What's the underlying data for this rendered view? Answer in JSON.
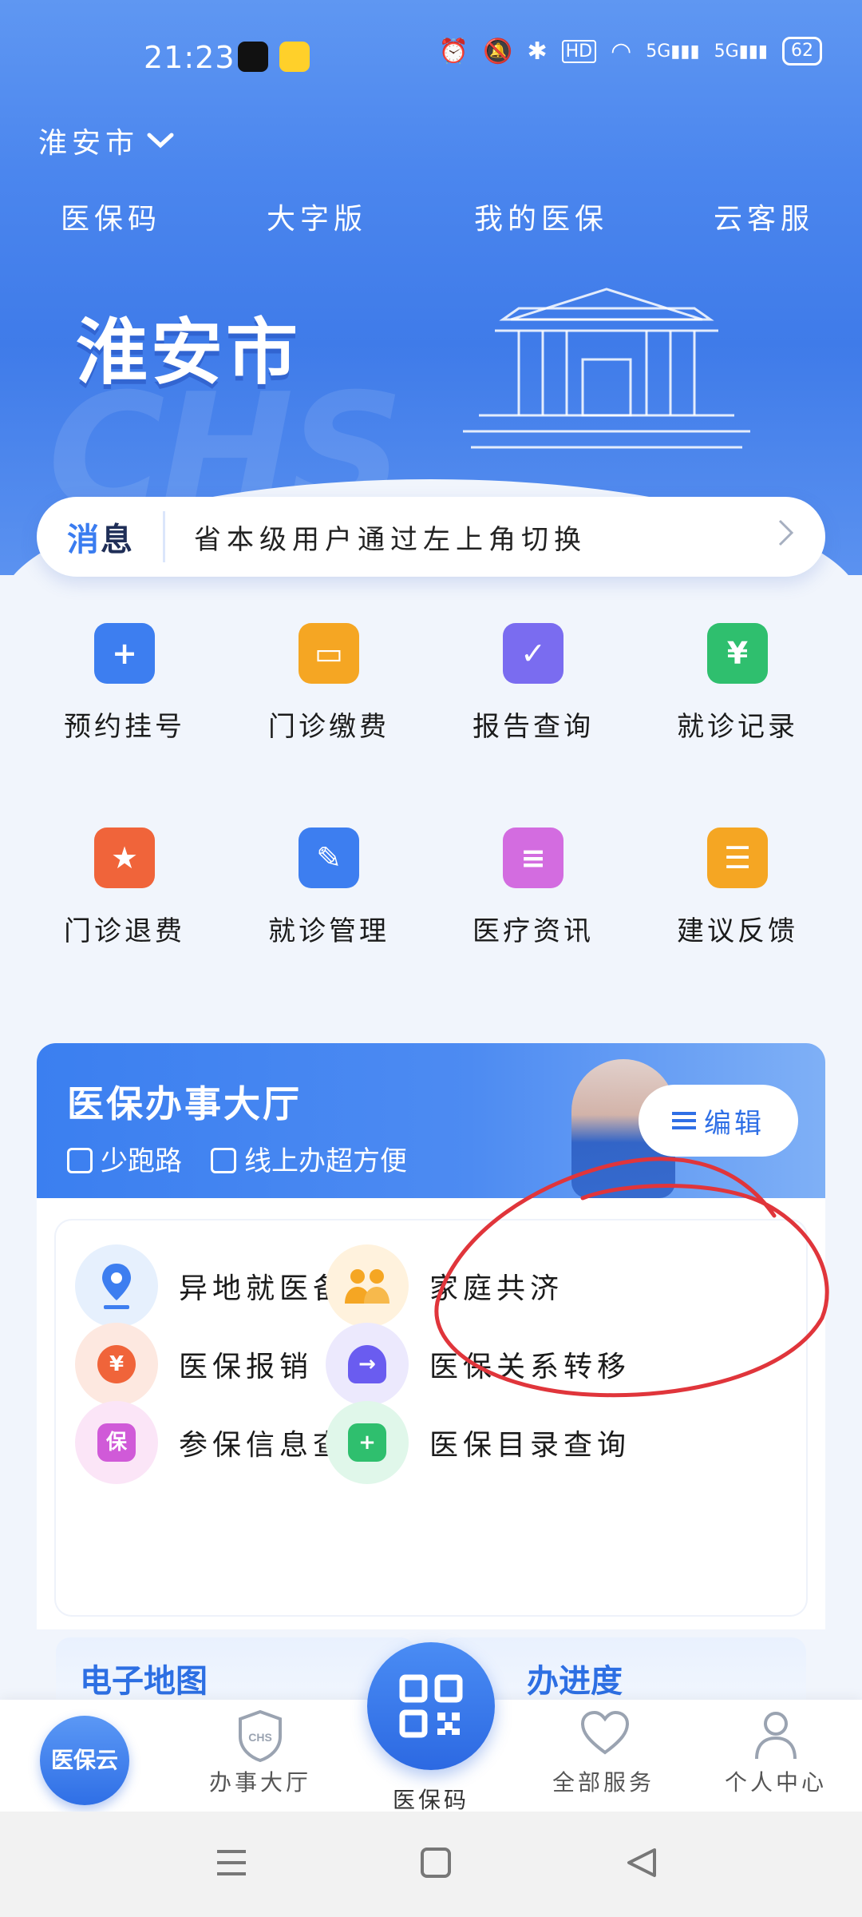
{
  "status_bar": {
    "time": "21:23",
    "network": "5G",
    "battery": "62"
  },
  "city": {
    "name": "淮安市"
  },
  "top_nav": [
    "医保码",
    "大字版",
    "我的医保",
    "云客服"
  ],
  "banner": {
    "city": "淮安市",
    "watermark": "CHS"
  },
  "notice": {
    "tag_part1": "消",
    "tag_part2": "息",
    "text": "省本级用户通过左上角切换"
  },
  "grid": [
    {
      "label": "预约挂号",
      "icon": "calendar-plus-icon",
      "color": "#3d7ef0"
    },
    {
      "label": "门诊缴费",
      "icon": "wallet-icon",
      "color": "#f5a623"
    },
    {
      "label": "报告查询",
      "icon": "calendar-check-icon",
      "color": "#7a6cf0"
    },
    {
      "label": "就诊记录",
      "icon": "receipt-yen-icon",
      "color": "#2fbf6e"
    },
    {
      "label": "门诊退费",
      "icon": "refund-star-icon",
      "color": "#f0643a"
    },
    {
      "label": "就诊管理",
      "icon": "edit-icon",
      "color": "#3d7ef0"
    },
    {
      "label": "医疗资讯",
      "icon": "news-tray-icon",
      "color": "#d36ce0"
    },
    {
      "label": "建议反馈",
      "icon": "clipboard-icon",
      "color": "#f5a623"
    }
  ],
  "hall": {
    "title": "医保办事大厅",
    "sub1": "少跑路",
    "sub2": "线上办超方便",
    "edit": "编辑"
  },
  "services": [
    {
      "label": "异地就医备案",
      "icon": "location-pin-icon",
      "bg": "#e6f0fd",
      "fg": "#3d7ef0"
    },
    {
      "label": "家庭共济",
      "icon": "family-icon",
      "bg": "#fff2dd",
      "fg": "#f5a623"
    },
    {
      "label": "医保报销",
      "icon": "yen-refund-icon",
      "bg": "#fde8e0",
      "fg": "#f0643a"
    },
    {
      "label": "医保关系转移",
      "icon": "user-transfer-icon",
      "bg": "#ece9fd",
      "fg": "#6a5cf0"
    },
    {
      "label": "参保信息查询",
      "icon": "insurance-search-icon",
      "bg": "#fbe5f7",
      "fg": "#d05ad8"
    },
    {
      "label": "医保目录查询",
      "icon": "catalog-plus-icon",
      "bg": "#e0f7ea",
      "fg": "#2fbf6e"
    }
  ],
  "bottom_cards": {
    "left": "电子地图",
    "right": "办进度"
  },
  "tabs": {
    "home": "医保云",
    "hall": "办事大厅",
    "qr": "医保码",
    "all": "全部服务",
    "me": "个人中心"
  }
}
